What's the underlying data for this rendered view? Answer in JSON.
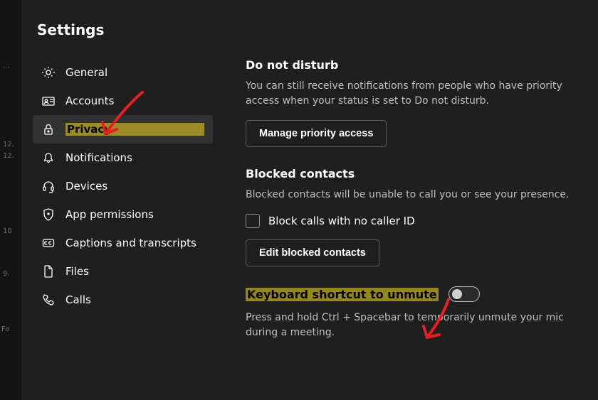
{
  "page": {
    "title": "Settings"
  },
  "sidebar": {
    "items": [
      {
        "label": "General"
      },
      {
        "label": "Accounts"
      },
      {
        "label": "Privacy"
      },
      {
        "label": "Notifications"
      },
      {
        "label": "Devices"
      },
      {
        "label": "App permissions"
      },
      {
        "label": "Captions and transcripts"
      },
      {
        "label": "Files"
      },
      {
        "label": "Calls"
      }
    ]
  },
  "dnd": {
    "title": "Do not disturb",
    "desc": "You can still receive notifications from people who have priority access when your status is set to Do not disturb.",
    "button": "Manage priority access"
  },
  "blocked": {
    "title": "Blocked contacts",
    "desc": "Blocked contacts will be unable to call you or see your presence.",
    "checkbox_label": "Block calls with no caller ID",
    "button": "Edit blocked contacts"
  },
  "unmute": {
    "title": "Keyboard shortcut to unmute",
    "desc": "Press and hold Ctrl + Spacebar to temporarily unmute your mic during a meeting."
  },
  "strip": {
    "a": "12.",
    "b": "10",
    "c": "9.",
    "d": "Fo"
  }
}
